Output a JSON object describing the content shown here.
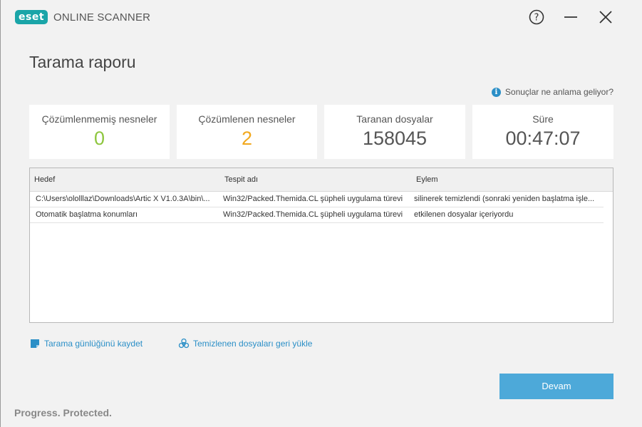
{
  "app": {
    "logo": "eset",
    "name": "ONLINE SCANNER"
  },
  "window_controls": {
    "help_icon": "question-circle-icon",
    "minimize_icon": "minimize-icon",
    "close_icon": "close-icon"
  },
  "page": {
    "title": "Tarama raporu"
  },
  "help_link": {
    "label": "Sonuçlar ne anlama geliyor?",
    "icon": "info-icon"
  },
  "stats": [
    {
      "label": "Çözümlenmemiş nesneler",
      "value": "0",
      "color": "#8ec63f"
    },
    {
      "label": "Çözümlenen nesneler",
      "value": "2",
      "color": "#f2a81d"
    },
    {
      "label": "Taranan dosyalar",
      "value": "158045",
      "color": "#555555"
    },
    {
      "label": "Süre",
      "value": "00:47:07",
      "color": "#555555"
    }
  ],
  "table": {
    "headers": [
      "Hedef",
      "Tespit adı",
      "Eylem"
    ],
    "rows": [
      [
        "C:\\Users\\ololllaz\\Downloads\\Artic X V1.0.3A\\bin\\...",
        "Win32/Packed.Themida.CL şüpheli uygulama türevi",
        "silinerek temizlendi (sonraki yeniden başlatma işle..."
      ],
      [
        "Otomatik başlatma konumları",
        "Win32/Packed.Themida.CL şüpheli uygulama türevi",
        "etkilenen dosyalar içeriyordu"
      ]
    ]
  },
  "actions": {
    "save_log": {
      "label": "Tarama günlüğünü kaydet",
      "icon": "save-document-icon"
    },
    "restore": {
      "label": "Temizlenen dosyaları geri yükle",
      "icon": "biohazard-icon"
    }
  },
  "continue_button": {
    "label": "Devam",
    "color": "#4da9d9"
  },
  "footer": {
    "tagline": "Progress. Protected."
  }
}
